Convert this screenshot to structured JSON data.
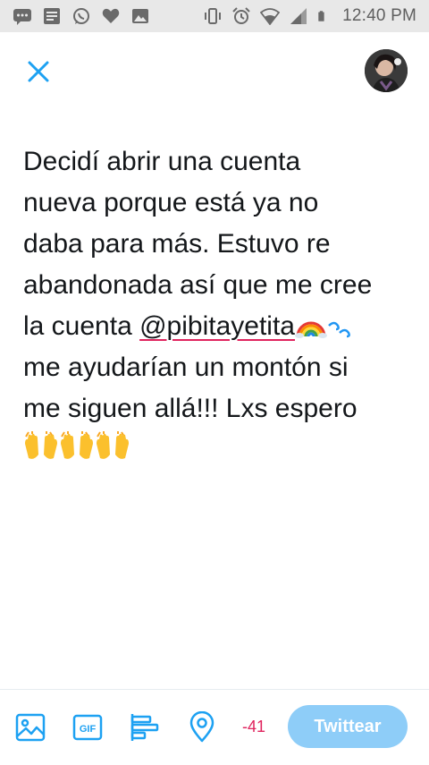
{
  "status_bar": {
    "time": "12:40 PM",
    "icons_left": [
      "message-icon",
      "news-icon",
      "whatsapp-icon",
      "heart-icon",
      "gallery-icon"
    ],
    "icons_right": [
      "vibrate-icon",
      "alarm-icon",
      "wifi-icon",
      "signal-icon",
      "battery-icon"
    ]
  },
  "header": {
    "close_icon": "close-icon",
    "avatar": "profile-avatar"
  },
  "composer": {
    "lines": [
      "Decidí abrir una cuenta",
      "nueva porque está ya no",
      "daba para más. Estuvo re",
      "abandonada así que me cree"
    ],
    "line5_prefix": "la cuenta ",
    "mention": "@pibitayetita",
    "line6": "me ayudarían un montón si",
    "line7": "me siguen allá!!! Lxs espero",
    "emojis_line5": [
      "rainbow-emoji",
      "wave-emoji"
    ],
    "emojis_line8": [
      "raised-hands-emoji",
      "raised-hands-emoji",
      "raised-hands-emoji"
    ]
  },
  "toolbar": {
    "icons": [
      "image-icon",
      "gif-icon",
      "poll-icon",
      "location-icon"
    ],
    "gif_label": "GIF",
    "char_count": "-41",
    "tweet_button": "Twittear"
  },
  "colors": {
    "accent": "#1da1f2",
    "tweet_button_disabled": "#8ecdf8",
    "error": "#e0245e",
    "status_bar_bg": "#e8e8e8",
    "text": "#14171a"
  }
}
